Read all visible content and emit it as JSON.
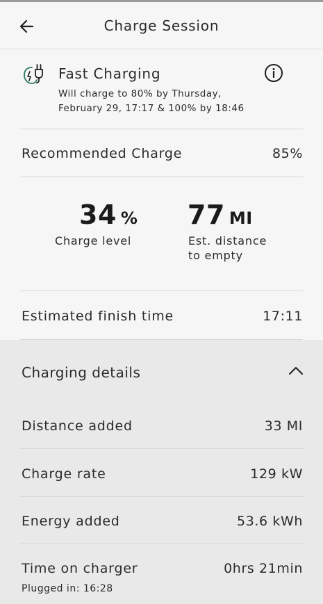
{
  "header": {
    "title": "Charge Session",
    "back_icon": "arrow-left-icon"
  },
  "status": {
    "icon": "ev-plug-icon",
    "title": "Fast Charging",
    "description": "Will charge to 80% by Thursday, February 29, 17:17 & 100% by 18:46",
    "info_icon": "info-icon"
  },
  "recommended": {
    "label": "Recommended Charge",
    "value": "85%"
  },
  "stats": {
    "charge_level": {
      "value": "34",
      "unit": "%",
      "label": "Charge level"
    },
    "distance": {
      "value": "77",
      "unit": "MI",
      "label": "Est. distance to empty"
    }
  },
  "finish": {
    "label": "Estimated finish time",
    "value": "17:11"
  },
  "details": {
    "title": "Charging details",
    "expanded": true,
    "rows": [
      {
        "label": "Distance added",
        "value": "33 MI"
      },
      {
        "label": "Charge rate",
        "value": "129 kW"
      },
      {
        "label": "Energy added",
        "value": "53.6 kWh"
      },
      {
        "label": "Time on charger",
        "value": "0hrs 21min"
      }
    ],
    "plugged_in": "Plugged in: 16:28"
  },
  "colors": {
    "background": "#f6f6f6",
    "details_background": "#e9e9ea",
    "text": "#2a2a2a",
    "accent": "#2b7a5e"
  }
}
